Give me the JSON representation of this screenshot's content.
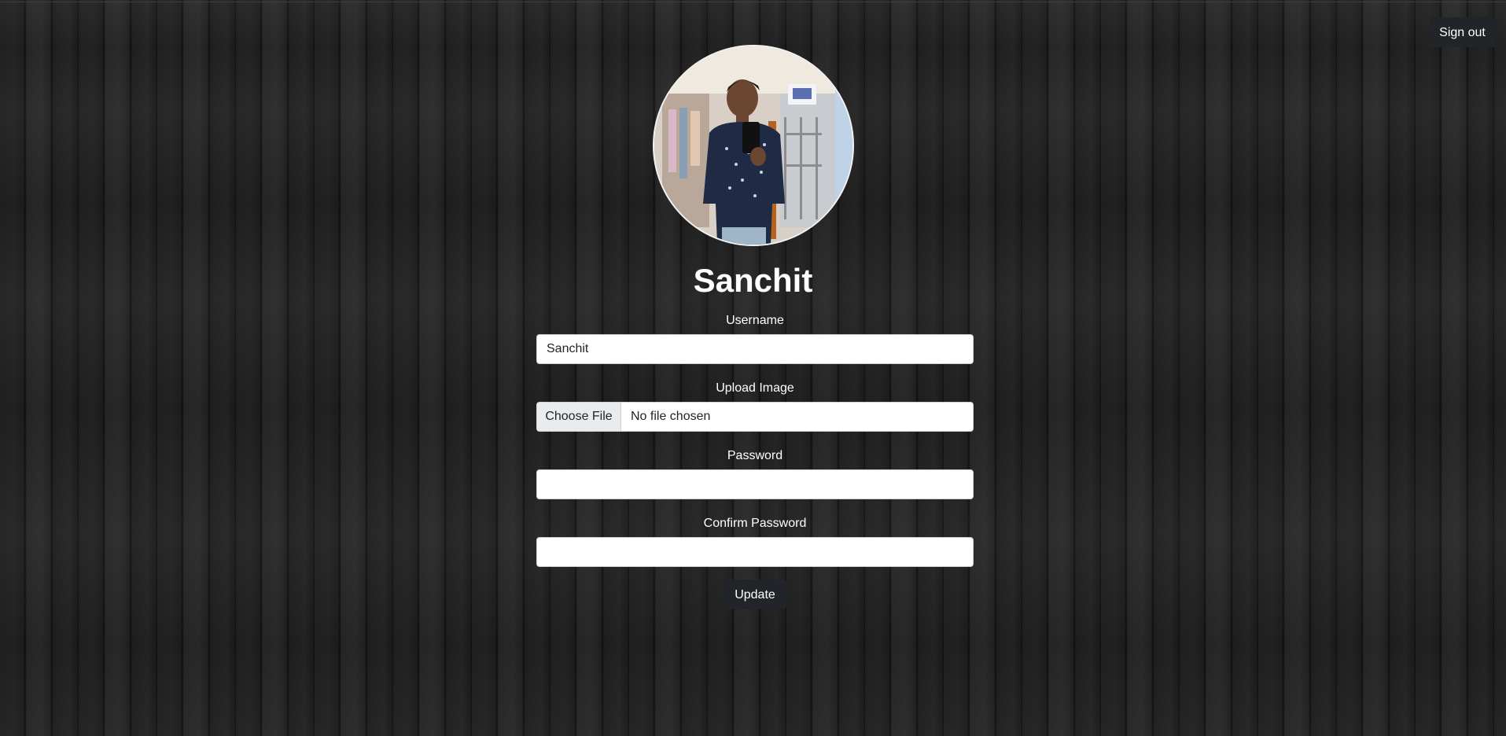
{
  "header": {
    "signout_label": "Sign out"
  },
  "profile": {
    "name": "Sanchit",
    "avatar_alt": "profile photo"
  },
  "form": {
    "username_label": "Username",
    "username_value": "Sanchit",
    "upload_label": "Upload Image",
    "choose_file_label": "Choose File",
    "file_status": "No file chosen",
    "password_label": "Password",
    "password_value": "",
    "confirm_label": "Confirm Password",
    "confirm_value": "",
    "update_label": "Update"
  },
  "colors": {
    "button_bg": "#212529",
    "page_bg": "#1c1c1c",
    "text": "#ffffff"
  }
}
